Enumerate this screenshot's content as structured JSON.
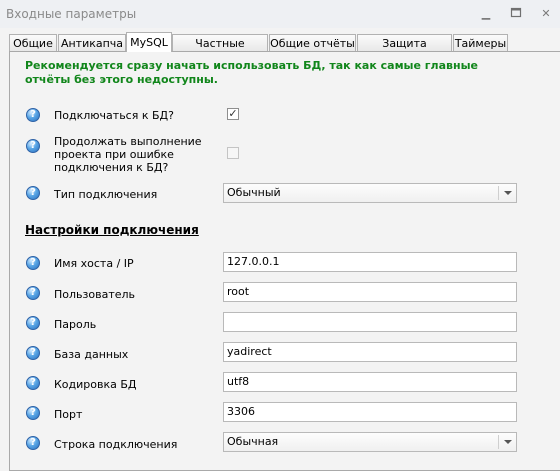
{
  "window": {
    "title": "Входные параметры"
  },
  "tabs": [
    "Общие",
    "Антикапча",
    "MySQL",
    "Частные отчёты",
    "Общие отчёты",
    "Защита отчётов",
    "Таймеры"
  ],
  "warning": "Рекомендуется сразу начать использовать БД, так как самые главные отчёты без этого недоступны.",
  "settings": {
    "connect_label": "Подключаться к БД?",
    "continue_label": "Продолжать выполнение проекта при ошибке подключения к БД?",
    "connection_type_label": "Тип подключения",
    "connection_type_value": "Обычный"
  },
  "section_title": "Настройки подключения",
  "connection": {
    "host_label": "Имя хоста / IP",
    "host_value": "127.0.0.1",
    "user_label": "Пользователь",
    "user_value": "root",
    "password_label": "Пароль",
    "password_value": "",
    "db_label": "База данных",
    "db_value": "yadirect",
    "encoding_label": "Кодировка БД",
    "encoding_value": "utf8",
    "port_label": "Порт",
    "port_value": "3306",
    "string_label": "Строка подключения",
    "string_value": "Обычная"
  }
}
